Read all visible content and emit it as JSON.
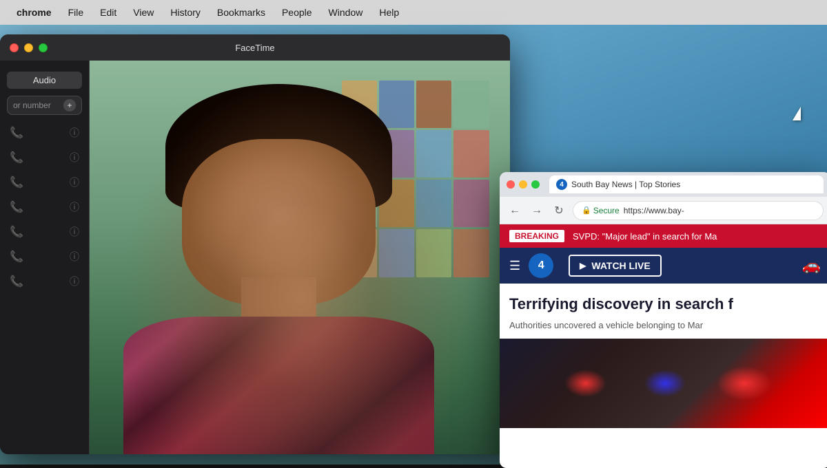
{
  "menubar": {
    "items": [
      {
        "label": "chrome",
        "bold": true
      },
      {
        "label": "File"
      },
      {
        "label": "Edit"
      },
      {
        "label": "View"
      },
      {
        "label": "History"
      },
      {
        "label": "Bookmarks"
      },
      {
        "label": "People"
      },
      {
        "label": "Window"
      },
      {
        "label": "Help"
      }
    ]
  },
  "facetime": {
    "title": "FaceTime",
    "audio_button": "Audio",
    "search_placeholder": "or number",
    "contacts": [
      {
        "id": 1
      },
      {
        "id": 2
      },
      {
        "id": 3
      },
      {
        "id": 4
      },
      {
        "id": 5
      },
      {
        "id": 6
      },
      {
        "id": 7
      }
    ]
  },
  "chrome": {
    "tab_title": "South Bay News | Top Stories",
    "nav": {
      "back": "←",
      "forward": "→",
      "refresh": "↻"
    },
    "address": {
      "secure_label": "Secure",
      "url": "https://www.bay-"
    },
    "breaking": {
      "label": "BREAKING",
      "text": "SVPD: \"Major lead\" in search for Ma"
    },
    "navbar": {
      "watch_live": "WATCH LIVE"
    },
    "headline": "Terrifying discovery in search f",
    "subtext": "Authorities uncovered a vehicle belonging to Mar"
  }
}
